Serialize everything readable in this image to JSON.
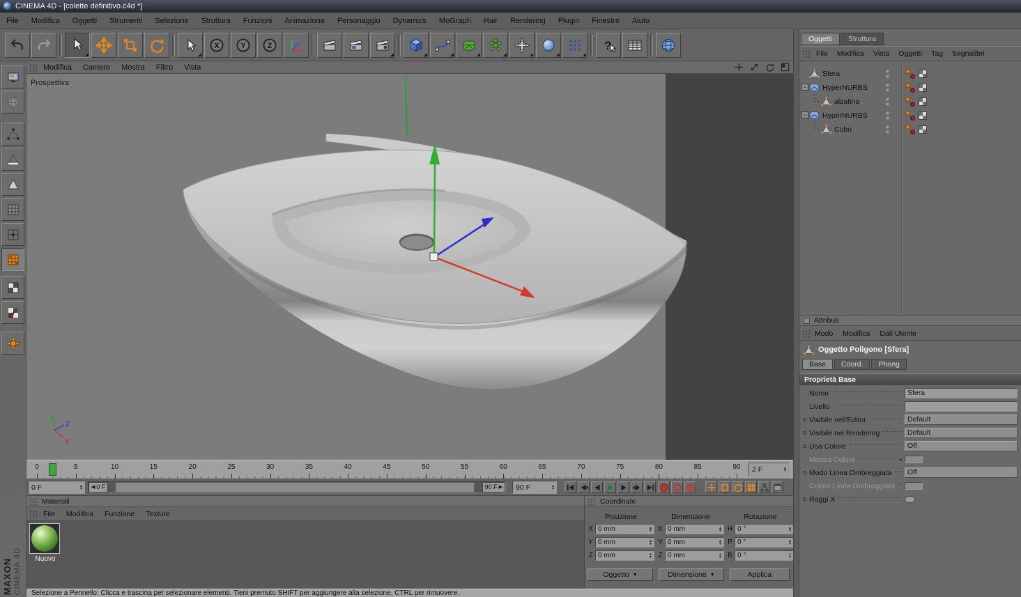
{
  "window": {
    "title": "CINEMA 4D - [colette definitivo.c4d *]"
  },
  "menubar": {
    "items": [
      "File",
      "Modifica",
      "Oggetti",
      "Strumenti",
      "Selezione",
      "Struttura",
      "Funzioni",
      "Animazione",
      "Personaggio",
      "Dynamics",
      "MoGraph",
      "Hair",
      "Rendering",
      "Plugin",
      "Finestre",
      "Aiuto"
    ]
  },
  "viewport": {
    "label": "Prospettiva",
    "menu": [
      "Modifica",
      "Camere",
      "Mostra",
      "Filtro",
      "Vista"
    ]
  },
  "object_manager": {
    "tabs": [
      "Oggetti",
      "Struttura"
    ],
    "active_tab_index": 0,
    "menu": [
      "File",
      "Modifica",
      "Vista",
      "Oggetti",
      "Tag",
      "Segnalibri"
    ],
    "tree": [
      {
        "label": "Sfera",
        "depth": 0,
        "icon": "polygon",
        "expander": false
      },
      {
        "label": "HyperNURBS",
        "depth": 0,
        "icon": "hypernurbs",
        "expander": true
      },
      {
        "label": "alzatina",
        "depth": 1,
        "icon": "polygon",
        "expander": false
      },
      {
        "label": "HyperNURBS",
        "depth": 0,
        "icon": "hypernurbs",
        "expander": true
      },
      {
        "label": "Cubo",
        "depth": 1,
        "icon": "polygon",
        "expander": false
      }
    ]
  },
  "attributes": {
    "title": "Attributi",
    "menu": [
      "Modo",
      "Modifica",
      "Dati Utente"
    ],
    "object_title": "Oggetto Poligono [Sfera]",
    "tabs": [
      "Base",
      "Coord.",
      "Phong"
    ],
    "active_tab": "Base",
    "section": "Proprietà Base",
    "rows": [
      {
        "label": "Nome",
        "value": "Sfera",
        "type": "text",
        "anim": false,
        "disabled": false
      },
      {
        "label": "Livello",
        "value": "",
        "type": "text",
        "anim": false,
        "disabled": false
      },
      {
        "label": "Visibile nell'Editor",
        "value": "Default",
        "type": "dropdown",
        "anim": true,
        "disabled": false
      },
      {
        "label": "Visibile nel Rendering",
        "value": "Default",
        "type": "dropdown",
        "anim": true,
        "disabled": false
      },
      {
        "label": "Usa Colore",
        "value": "Off",
        "type": "dropdown",
        "anim": true,
        "disabled": false
      },
      {
        "label": "Mostra Colore",
        "value": "",
        "type": "color",
        "anim": false,
        "disabled": true,
        "arrow": true
      },
      {
        "label": "Modo Linea Ombreggiata",
        "value": "Off",
        "type": "dropdown",
        "anim": true,
        "disabled": false
      },
      {
        "label": "Colore Linea Ombreggiata",
        "value": "",
        "type": "color",
        "anim": false,
        "disabled": true
      },
      {
        "label": "Raggi X",
        "value": "",
        "type": "checkbox",
        "anim": true,
        "disabled": false
      }
    ]
  },
  "timeline": {
    "ticks": [
      0,
      5,
      10,
      15,
      20,
      25,
      30,
      35,
      40,
      45,
      50,
      55,
      60,
      65,
      70,
      75,
      80,
      85,
      90
    ],
    "current_frame": 2,
    "current_field": "2 F",
    "start_field": "0 F",
    "end_field": "90 F",
    "range_start_label": "0 F",
    "range_end_label": "90 F"
  },
  "materials": {
    "title": "Materiali",
    "menu": [
      "File",
      "Modifica",
      "Funzione",
      "Texture"
    ],
    "items": [
      {
        "name": "Nuovo"
      }
    ]
  },
  "coordinates": {
    "title": "Coordinate",
    "groups": [
      {
        "title": "Posizione",
        "rows": [
          {
            "axis": "X",
            "value": "0 mm"
          },
          {
            "axis": "Y",
            "value": "0 mm"
          },
          {
            "axis": "Z",
            "value": "0 mm"
          }
        ]
      },
      {
        "title": "Dimensione",
        "rows": [
          {
            "axis": "X",
            "value": "0 mm"
          },
          {
            "axis": "Y",
            "value": "0 mm"
          },
          {
            "axis": "Z",
            "value": "0 mm"
          }
        ]
      },
      {
        "title": "Rotazione",
        "rows": [
          {
            "axis": "H",
            "value": "0 °"
          },
          {
            "axis": "P",
            "value": "0 °"
          },
          {
            "axis": "B",
            "value": "0 °"
          }
        ]
      }
    ],
    "buttons": {
      "mode1": "Oggetto",
      "mode2": "Dimensione",
      "apply": "Applica"
    }
  },
  "statusbar": {
    "text": "Selezione a Pennello: Clicca e trascina per selezionare elementi. Tieni premuto SHIFT per aggiungere alla selezione, CTRL per rimuovere."
  },
  "branding": {
    "maxon": "MAXON",
    "cinema": "CINEMA 4D"
  },
  "icons": {
    "axis_x": "X",
    "axis_y": "Y",
    "axis_z": "Z",
    "question": "?"
  },
  "colors": {
    "accent_orange": "#e0851c",
    "gizmo_green": "#2fae2f",
    "gizmo_red": "#d23b2a",
    "gizmo_blue": "#2b2fd0",
    "material_green": "#6fae4f"
  }
}
